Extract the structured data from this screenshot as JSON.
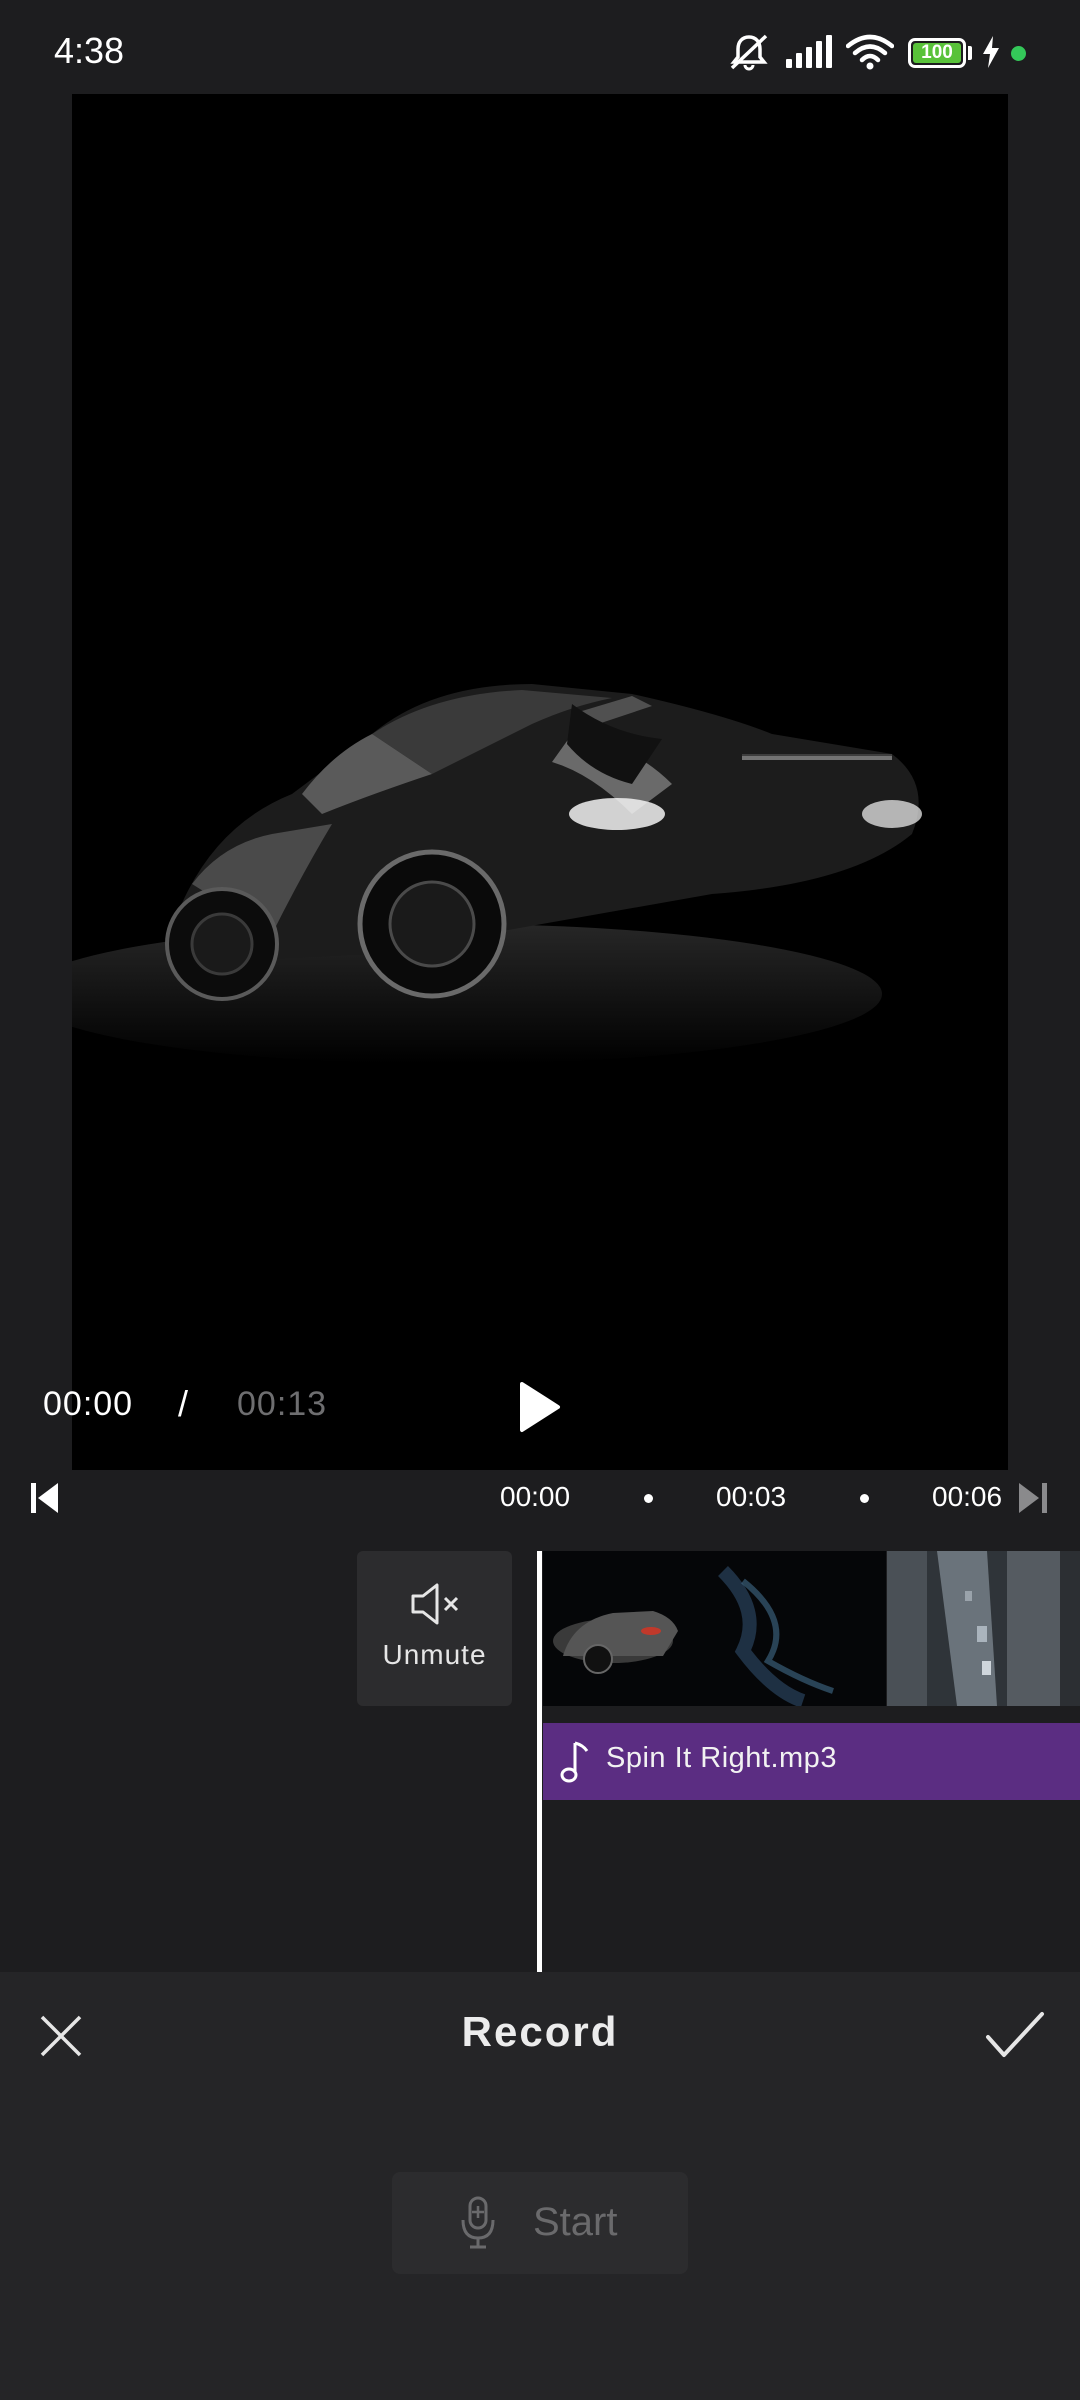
{
  "status_bar": {
    "time": "4:38",
    "battery_level": "100",
    "icons": [
      "mute-icon",
      "signal-icon",
      "wifi-icon",
      "battery-icon",
      "charging-icon",
      "dot-icon"
    ]
  },
  "player": {
    "current_time": "00:00",
    "separator": "/",
    "total_time": "00:13"
  },
  "timeline": {
    "ticks": [
      "00:00",
      "00:03",
      "00:06"
    ],
    "unmute_label": "Unmute",
    "audio_track_name": "Spin It Right.mp3"
  },
  "record_panel": {
    "title": "Record",
    "start_label": "Start"
  },
  "colors": {
    "background": "#1d1d1f",
    "panel": "#252527",
    "audio_track": "#5b2d82",
    "battery": "#59c23a"
  }
}
